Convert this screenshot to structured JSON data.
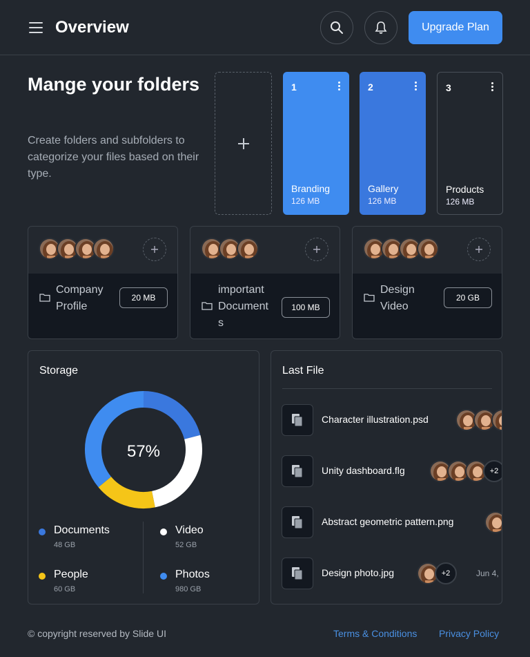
{
  "header": {
    "title": "Overview",
    "upgrade_label": "Upgrade Plan"
  },
  "hero": {
    "heading": "Mange your folders",
    "description": "Create folders and subfolders to categorize your files based on their type."
  },
  "folders": [
    {
      "num": "1",
      "name": "Branding",
      "size": "126 MB",
      "color": "#3f8cf0"
    },
    {
      "num": "2",
      "name": "Gallery",
      "size": "126 MB",
      "color": "#3a78de"
    },
    {
      "num": "3",
      "name": "Products",
      "size": "126 MB",
      "color": "#22272e"
    }
  ],
  "groups": [
    {
      "name": "Company Profile",
      "size": "20 MB"
    },
    {
      "name": "important Documents",
      "size": "100 MB"
    },
    {
      "name": "Design Video",
      "size": "20 GB"
    }
  ],
  "storage": {
    "title": "Storage",
    "percent": "57%",
    "items": [
      {
        "label": "Documents",
        "size": "48 GB",
        "color": "#3a78de"
      },
      {
        "label": "Video",
        "size": "52 GB",
        "color": "#ffffff"
      },
      {
        "label": "People",
        "size": "60 GB",
        "color": "#f5c518"
      },
      {
        "label": "Photos",
        "size": "980 GB",
        "color": "#3f8cf0"
      }
    ]
  },
  "last_file": {
    "title": "Last File",
    "files": [
      {
        "name": "Character illustration.psd"
      },
      {
        "name": "Unity dashboard.flg",
        "extra": "+2"
      },
      {
        "name": "Abstract geometric pattern.png"
      },
      {
        "name": "Design photo.jpg",
        "extra": "+2",
        "date": "Jun 4,"
      }
    ]
  },
  "footer": {
    "copyright": "© copyright reserved by Slide UI",
    "terms": "Terms & Conditions",
    "privacy": "Privacy Policy"
  }
}
